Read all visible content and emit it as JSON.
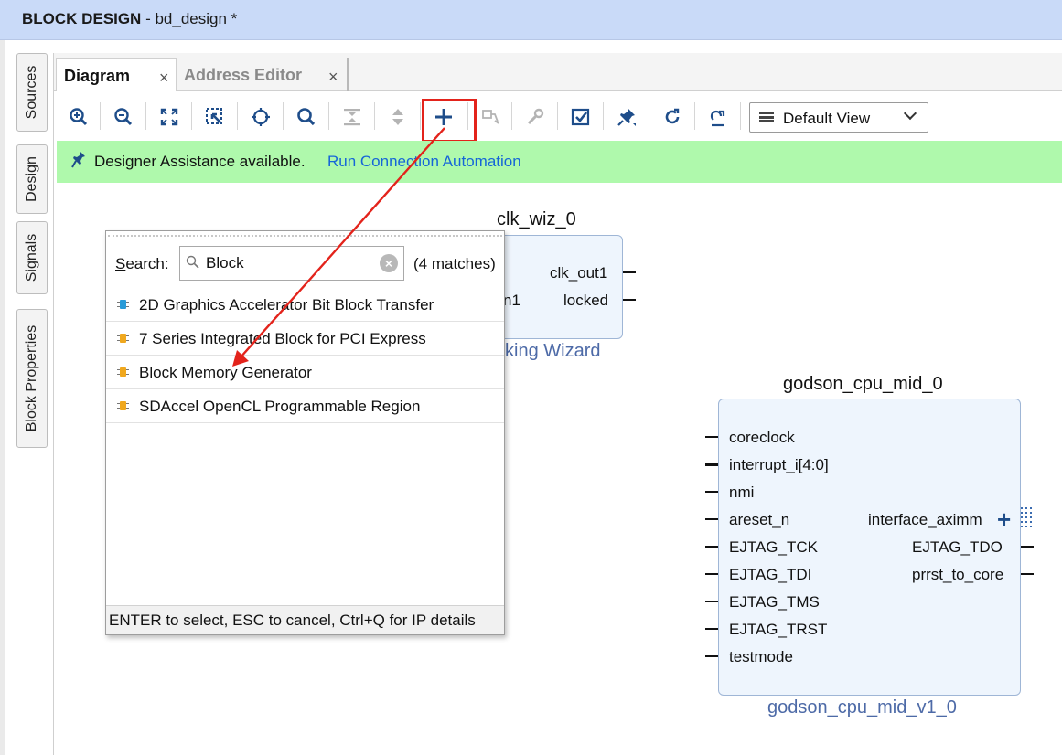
{
  "window": {
    "title_bold": "BLOCK DESIGN",
    "title_rest": " - bd_design *"
  },
  "side_tabs": [
    "Sources",
    "Design",
    "Signals",
    "Block Properties"
  ],
  "tabs": [
    {
      "label": "Diagram",
      "close": "×"
    },
    {
      "label": "Address Editor",
      "close": "×"
    }
  ],
  "toolbar": {
    "view_select": "Default View",
    "icons": [
      "zoom-in-icon",
      "zoom-out-icon",
      "fit-view-icon",
      "zoom-area-icon",
      "center-icon",
      "search-icon",
      "collapse-icon",
      "expand-icon",
      "add-ip-icon",
      "make-connection-icon",
      "settings-wrench-icon",
      "validate-icon",
      "pin-icon",
      "refresh-icon",
      "regenerate-layout-icon"
    ]
  },
  "assist": {
    "message": "Designer Assistance available.",
    "link": "Run Connection Automation"
  },
  "blocks": {
    "clk": {
      "name": "clk_wiz_0",
      "subtitle": "king Wizard",
      "left_port_partial": "n1",
      "outputs": [
        "clk_out1",
        "locked"
      ]
    },
    "cpu": {
      "name": "godson_cpu_mid_0",
      "subtitle": "godson_cpu_mid_v1_0",
      "inputs": [
        "coreclock",
        "interrupt_i[4:0]",
        "nmi",
        "areset_n",
        "EJTAG_TCK",
        "EJTAG_TDI",
        "EJTAG_TMS",
        "EJTAG_TRST",
        "testmode"
      ],
      "outputs": [
        "interface_aximm",
        "EJTAG_TDO",
        "prrst_to_core"
      ],
      "bus_plus": "+"
    }
  },
  "popup": {
    "search_label_u": "S",
    "search_label_rest": "earch:",
    "search_value": "Block",
    "matches": "(4 matches)",
    "items": [
      {
        "label": "2D Graphics Accelerator Bit Block Transfer",
        "icon_color": "#2a9bd8"
      },
      {
        "label": "7 Series Integrated Block for PCI Express",
        "icon_color": "#f0a81e"
      },
      {
        "label": "Block Memory Generator",
        "icon_color": "#f0a81e"
      },
      {
        "label": "SDAccel OpenCL Programmable Region",
        "icon_color": "#f0a81e"
      }
    ],
    "footer": "ENTER to select, ESC to cancel, Ctrl+Q for IP details"
  },
  "colors": {
    "highlight": "#e3231b",
    "assist_bg": "#aff9ac",
    "link": "#1565d8",
    "block_fill": "#eef5fd"
  }
}
